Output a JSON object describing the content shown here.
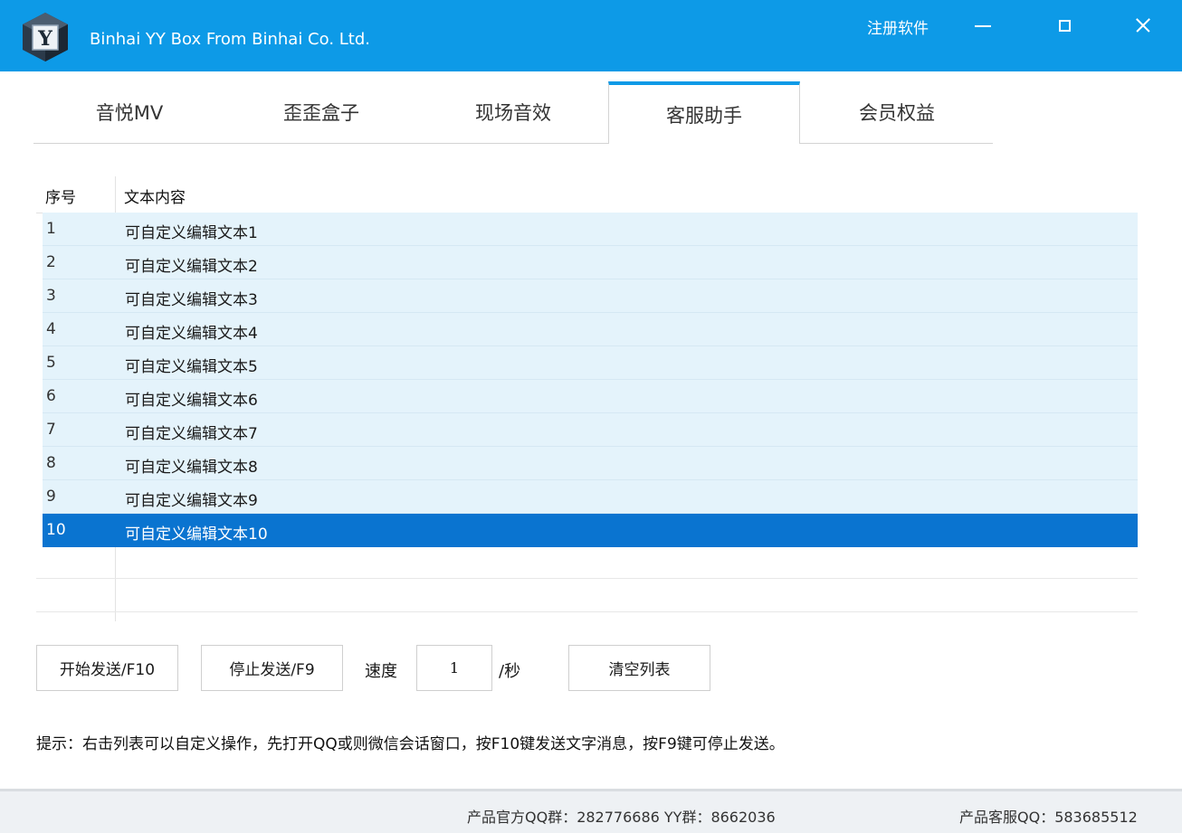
{
  "window": {
    "logo_letter": "Y",
    "title": "Binhai YY Box From Binhai Co. Ltd.",
    "register_label": "注册软件"
  },
  "tabs": [
    {
      "label": "音悦MV",
      "active": false
    },
    {
      "label": "歪歪盒子",
      "active": false
    },
    {
      "label": "现场音效",
      "active": false
    },
    {
      "label": "客服助手",
      "active": true
    },
    {
      "label": "会员权益",
      "active": false
    }
  ],
  "list": {
    "columns": [
      "序号",
      "文本内容"
    ],
    "rows": [
      {
        "num": "1",
        "text": "可自定义编辑文本1"
      },
      {
        "num": "2",
        "text": "可自定义编辑文本2"
      },
      {
        "num": "3",
        "text": "可自定义编辑文本3"
      },
      {
        "num": "4",
        "text": "可自定义编辑文本4"
      },
      {
        "num": "5",
        "text": "可自定义编辑文本5"
      },
      {
        "num": "6",
        "text": "可自定义编辑文本6"
      },
      {
        "num": "7",
        "text": "可自定义编辑文本7"
      },
      {
        "num": "8",
        "text": "可自定义编辑文本8"
      },
      {
        "num": "9",
        "text": "可自定义编辑文本9"
      },
      {
        "num": "10",
        "text": "可自定义编辑文本10"
      }
    ],
    "selected_row": "10"
  },
  "controls": {
    "start_label": "开始发送/F10",
    "stop_label": "停止发送/F9",
    "speed_label": "速度",
    "speed_value": "1",
    "speed_unit": "/秒",
    "clear_label": "清空列表"
  },
  "hint": "提示：右击列表可以自定义操作，先打开QQ或则微信会话窗口，按F10键发送文字消息，按F9键可停止发送。",
  "footer": {
    "qq_group": "产品官方QQ群：282776686  YY群：8662036",
    "service_qq": "产品客服QQ：583685512"
  },
  "colors": {
    "titlebar": "#0d9ae7",
    "row_bg": "#e4f3fb",
    "row_selected": "#0a74d0"
  }
}
